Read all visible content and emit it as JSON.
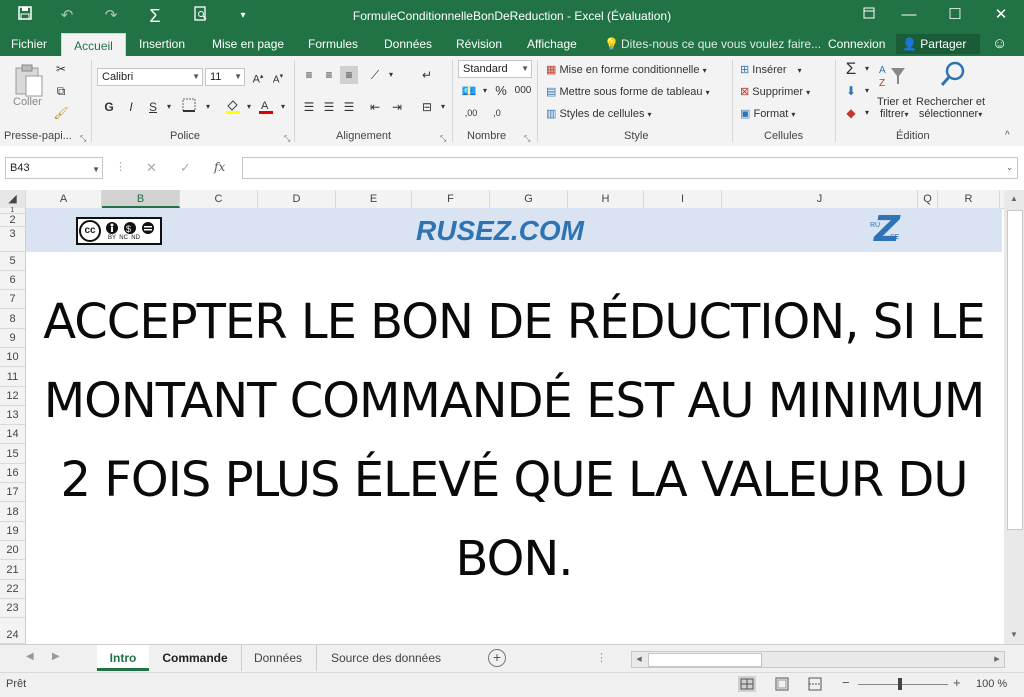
{
  "titlebar": {
    "title": "FormuleConditionnelleBonDeReduction - Excel (Évaluation)",
    "save_icon": "save-icon",
    "undo_icon": "undo-icon",
    "redo_icon": "redo-icon",
    "autosum_icon": "sigma-icon",
    "preview_icon": "print-preview-icon"
  },
  "tabs": {
    "file": "Fichier",
    "home": "Accueil",
    "insert": "Insertion",
    "layout": "Mise en page",
    "formulas": "Formules",
    "data": "Données",
    "review": "Révision",
    "view": "Affichage",
    "tellme": "Dites-nous ce que vous voulez faire...",
    "signin": "Connexion",
    "share": "Partager"
  },
  "ribbon": {
    "paste": "Coller",
    "clipboard": "Presse-papi...",
    "font_name": "Calibri",
    "font_size": "11",
    "bold": "G",
    "italic": "I",
    "underline": "S",
    "font_group": "Police",
    "align_group": "Alignement",
    "number_format": "Standard",
    "percent": "%",
    "thousands": "000",
    "dec_inc": ",00",
    "dec_dec": ",0",
    "number_group": "Nombre",
    "cond_format": "Mise en forme conditionnelle",
    "table_format": "Mettre sous forme de tableau",
    "cell_styles": "Styles de cellules",
    "styles_group": "Style",
    "insert": "Insérer",
    "delete": "Supprimer",
    "format": "Format",
    "cells_group": "Cellules",
    "sort_l1": "Trier et",
    "sort_l2": "filtrer",
    "find_l1": "Rechercher et",
    "find_l2": "sélectionner",
    "edit_group": "Édition"
  },
  "formula_bar": {
    "name_box": "B43",
    "fx": "fx",
    "formula": ""
  },
  "columns": [
    "A",
    "B",
    "C",
    "D",
    "E",
    "F",
    "G",
    "H",
    "I",
    "J",
    "Q",
    "R"
  ],
  "rows": [
    "1",
    "2",
    "3",
    "5",
    "6",
    "7",
    "8",
    "9",
    "10",
    "11",
    "12",
    "13",
    "14",
    "15",
    "16",
    "17",
    "18",
    "19",
    "20",
    "21",
    "22",
    "23",
    "24"
  ],
  "sheet": {
    "site": "RUSEZ.COM",
    "cc_badge": "cc",
    "cc_sub": "BY  NC  ND",
    "logo_ru": "RU",
    "logo_se": "SE",
    "logo_z": "Z",
    "message": "ACCEPTER LE BON DE RÉDUCTION, SI LE MONTANT COMMANDÉ EST AU MINIMUM 2 FOIS PLUS ÉLEVÉ QUE LA VALEUR DU BON."
  },
  "sheet_tabs": {
    "intro": "Intro",
    "commande": "Commande",
    "donnees": "Données",
    "source": "Source des données"
  },
  "status": {
    "ready": "Prêt",
    "zoom": "100 %"
  },
  "colors": {
    "excel_green": "#217346",
    "banner_blue": "#dae3f1",
    "site_text": "#2e74b5"
  }
}
